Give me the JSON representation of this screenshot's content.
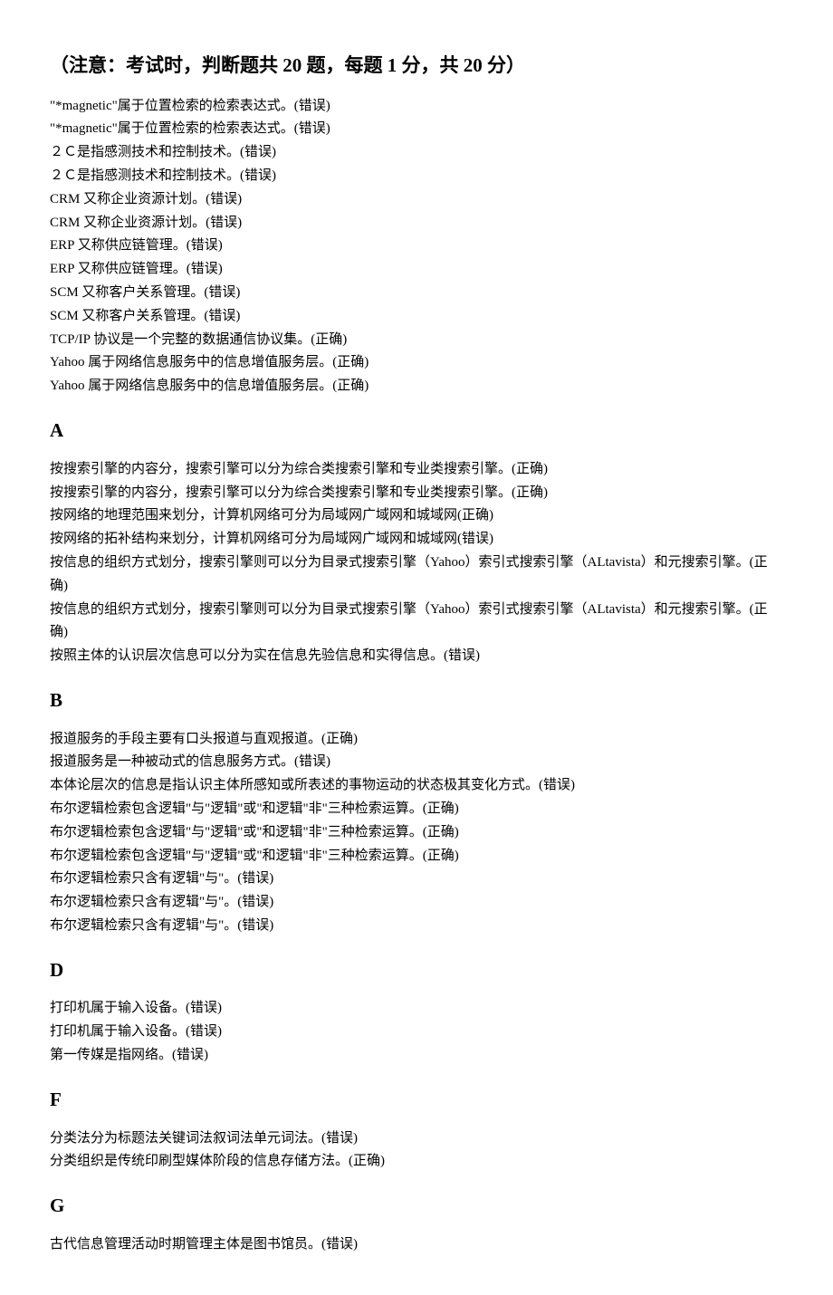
{
  "title": "（注意：考试时，判断题共 20 题，每题 1 分，共 20 分）",
  "intro": [
    "\"*magnetic\"属于位置检索的检索表达式。(错误)",
    "\"*magnetic\"属于位置检索的检索表达式。(错误)",
    "２Ｃ是指感测技术和控制技术。(错误)",
    "２Ｃ是指感测技术和控制技术。(错误)",
    "CRM 又称企业资源计划。(错误)",
    "CRM 又称企业资源计划。(错误)",
    "ERP 又称供应链管理。(错误)",
    "ERP 又称供应链管理。(错误)",
    "SCM 又称客户关系管理。(错误)",
    "SCM 又称客户关系管理。(错误)",
    "TCP/IP 协议是一个完整的数据通信协议集。(正确)",
    "Yahoo 属于网络信息服务中的信息增值服务层。(正确)",
    "Yahoo 属于网络信息服务中的信息增值服务层。(正确)"
  ],
  "sections": [
    {
      "heading": "A",
      "lines": [
        "按搜索引擎的内容分，搜索引擎可以分为综合类搜索引擎和专业类搜索引擎。(正确)",
        "按搜索引擎的内容分，搜索引擎可以分为综合类搜索引擎和专业类搜索引擎。(正确)",
        "按网络的地理范围来划分，计算机网络可分为局域网广域网和城域网(正确)",
        "按网络的拓补结构来划分，计算机网络可分为局域网广域网和城域网(错误)",
        "按信息的组织方式划分，搜索引擎则可以分为目录式搜索引擎（Yahoo）索引式搜索引擎（ALtavista）和元搜索引擎。(正确)",
        "按信息的组织方式划分，搜索引擎则可以分为目录式搜索引擎（Yahoo）索引式搜索引擎（ALtavista）和元搜索引擎。(正确)",
        "按照主体的认识层次信息可以分为实在信息先验信息和实得信息。(错误)"
      ]
    },
    {
      "heading": "B",
      "lines": [
        "报道服务的手段主要有口头报道与直观报道。(正确)",
        "报道服务是一种被动式的信息服务方式。(错误)",
        "本体论层次的信息是指认识主体所感知或所表述的事物运动的状态极其变化方式。(错误)",
        "布尔逻辑检索包含逻辑\"与\"逻辑\"或\"和逻辑\"非\"三种检索运算。(正确)",
        "布尔逻辑检索包含逻辑\"与\"逻辑\"或\"和逻辑\"非\"三种检索运算。(正确)",
        "布尔逻辑检索包含逻辑\"与\"逻辑\"或\"和逻辑\"非\"三种检索运算。(正确)",
        "布尔逻辑检索只含有逻辑\"与\"。(错误)",
        "布尔逻辑检索只含有逻辑\"与\"。(错误)",
        "布尔逻辑检索只含有逻辑\"与\"。(错误)"
      ]
    },
    {
      "heading": "D",
      "lines": [
        "打印机属于输入设备。(错误)",
        "打印机属于输入设备。(错误)",
        "第一传媒是指网络。(错误)"
      ]
    },
    {
      "heading": "F",
      "lines": [
        "分类法分为标题法关键词法叙词法单元词法。(错误)",
        "分类组织是传统印刷型媒体阶段的信息存储方法。(正确)"
      ]
    },
    {
      "heading": "G",
      "lines": [
        "古代信息管理活动时期管理主体是图书馆员。(错误)"
      ]
    }
  ]
}
